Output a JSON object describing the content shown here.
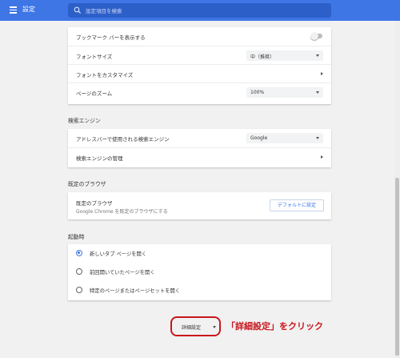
{
  "header": {
    "title": "設定",
    "search_placeholder": "設定項目を検索"
  },
  "appearance": {
    "rows": [
      {
        "label": "ブックマーク バーを表示する",
        "control": "toggle",
        "value": false
      },
      {
        "label": "フォントサイズ",
        "control": "select",
        "value": "中（推奨）"
      },
      {
        "label": "フォントをカスタマイズ",
        "control": "link"
      },
      {
        "label": "ページのズーム",
        "control": "select",
        "value": "100%"
      }
    ]
  },
  "search_engine": {
    "title": "検索エンジン",
    "rows": [
      {
        "label": "アドレスバーで使用される検索エンジン",
        "control": "select",
        "value": "Google"
      },
      {
        "label": "検索エンジンの管理",
        "control": "link"
      }
    ]
  },
  "default_browser": {
    "title": "既定のブラウザ",
    "line1": "既定のブラウザ",
    "line2": "Google Chrome を既定のブラウザにする",
    "button": "デフォルトに設定"
  },
  "on_startup": {
    "title": "起動時",
    "options": [
      {
        "label": "新しいタブ ページを開く",
        "selected": true
      },
      {
        "label": "前回開いていたページを開く",
        "selected": false
      },
      {
        "label": "特定のページまたはページセットを開く",
        "selected": false
      }
    ]
  },
  "advanced": {
    "label": "詳細設定"
  },
  "annotation": {
    "text": "「詳細設定」をクリック",
    "color": "#c8161d"
  },
  "colors": {
    "header": "#3f76e6",
    "accent": "#3f76e6"
  }
}
